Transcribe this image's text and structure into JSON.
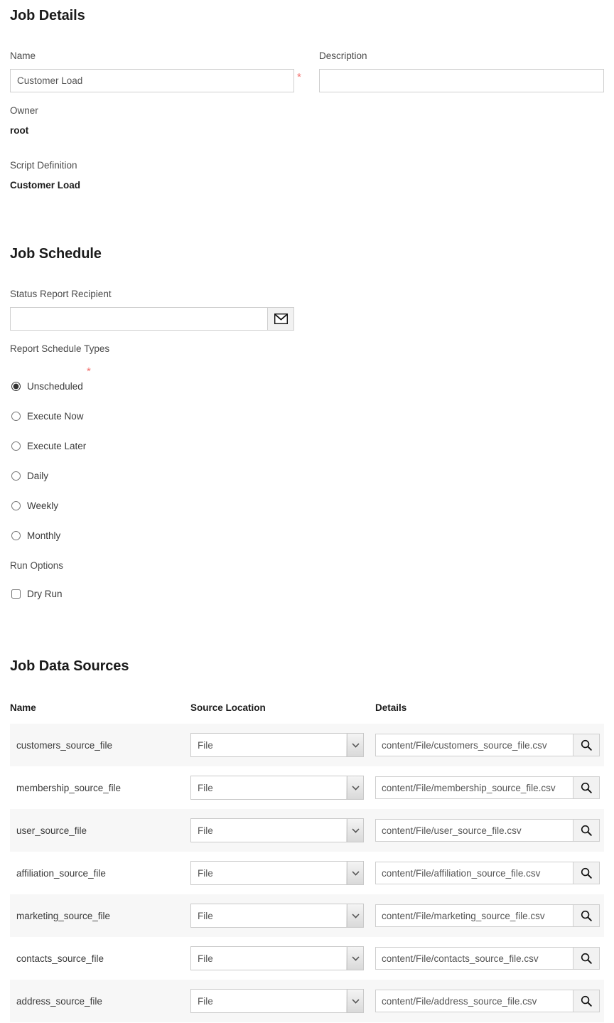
{
  "job_details": {
    "section_title": "Job Details",
    "name_label": "Name",
    "name_value": "Customer Load",
    "name_required_mark": "*",
    "description_label": "Description",
    "description_value": "",
    "description_placeholder": "",
    "owner_label": "Owner",
    "owner_value": "root",
    "script_definition_label": "Script Definition",
    "script_definition_value": "Customer Load"
  },
  "job_schedule": {
    "section_title": "Job Schedule",
    "recipient_label": "Status Report Recipient",
    "recipient_value": "",
    "recipient_placeholder": "",
    "recipient_icon": "envelope-icon",
    "schedule_types_label": "Report Schedule Types",
    "schedule_types_required_mark": "*",
    "schedule_types": [
      {
        "label": "Unscheduled",
        "selected": true
      },
      {
        "label": "Execute Now",
        "selected": false
      },
      {
        "label": "Execute Later",
        "selected": false
      },
      {
        "label": "Daily",
        "selected": false
      },
      {
        "label": "Weekly",
        "selected": false
      },
      {
        "label": "Monthly",
        "selected": false
      }
    ],
    "run_options_label": "Run Options",
    "run_options": [
      {
        "label": "Dry Run",
        "checked": false
      }
    ]
  },
  "job_data_sources": {
    "section_title": "Job Data Sources",
    "columns": [
      "Name",
      "Source Location",
      "Details"
    ],
    "search_icon": "magnifier-icon",
    "location_options": [
      "File"
    ],
    "rows": [
      {
        "name": "customers_source_file",
        "location": "File",
        "details": "content/File/customers_source_file.csv"
      },
      {
        "name": "membership_source_file",
        "location": "File",
        "details": "content/File/membership_source_file.csv"
      },
      {
        "name": "user_source_file",
        "location": "File",
        "details": "content/File/user_source_file.csv"
      },
      {
        "name": "affiliation_source_file",
        "location": "File",
        "details": "content/File/affiliation_source_file.csv"
      },
      {
        "name": "marketing_source_file",
        "location": "File",
        "details": "content/File/marketing_source_file.csv"
      },
      {
        "name": "contacts_source_file",
        "location": "File",
        "details": "content/File/contacts_source_file.csv"
      },
      {
        "name": "address_source_file",
        "location": "File",
        "details": "content/File/address_source_file.csv"
      }
    ]
  },
  "colors": {
    "required_star": "#f2706d",
    "row_alt_background": "#f7f7f7",
    "input_border": "#cfcfcf",
    "heading": "#1b1b1b"
  }
}
